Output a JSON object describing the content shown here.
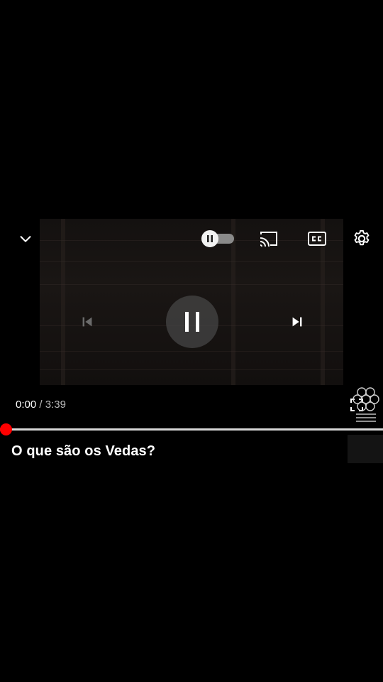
{
  "player": {
    "time_current": "0:00",
    "time_separator": " / ",
    "time_total": "3:39",
    "progress_fraction": 0.0,
    "autoplay_on": false
  },
  "icons": {
    "collapse": "chevron-down-icon",
    "autoplay": "pause-toggle-icon",
    "cast": "cast-icon",
    "captions": "cc-icon",
    "settings": "gear-icon",
    "previous": "skip-previous-icon",
    "play_pause": "pause-icon",
    "next": "skip-next-icon",
    "fullscreen": "fullscreen-icon",
    "watermark": "channel-watermark-logo"
  },
  "video": {
    "title": "O que são os Vedas?"
  },
  "colors": {
    "accent": "#ff0000",
    "background": "#000000",
    "text": "#ffffff"
  }
}
